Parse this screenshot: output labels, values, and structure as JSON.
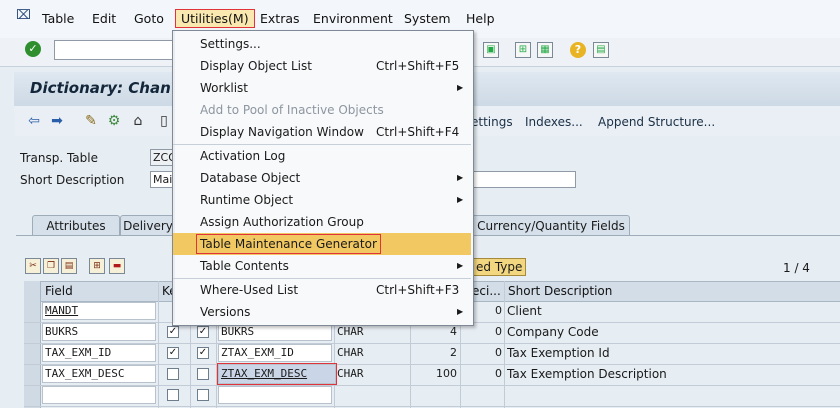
{
  "menubar": {
    "items": [
      "Table",
      "Edit",
      "Goto",
      "Utilities(M)",
      "Extras",
      "Environment",
      "System",
      "Help"
    ]
  },
  "title": "Dictionary: Chan",
  "app_toolbar": {
    "links": [
      "ettings",
      "Indexes...",
      "Append Structure..."
    ]
  },
  "form": {
    "transp_table_label": "Transp. Table",
    "transp_table_value": "ZCO",
    "short_desc_label": "Short Description",
    "short_desc_value": "Mai"
  },
  "tabs": [
    "Attributes",
    "Delivery",
    "Currency/Quantity Fields"
  ],
  "grid": {
    "tab_partial": "ed Type",
    "counter": "1 / 4",
    "headers": {
      "field": "Field",
      "key": "Ke",
      "deci": "eci...",
      "short_desc": "Short Description"
    },
    "rows": [
      {
        "field": "MANDT",
        "key": "",
        "init": "",
        "element": "",
        "type": "",
        "length": "",
        "decimals": "0",
        "desc": "Client"
      },
      {
        "field": "BUKRS",
        "key": "✓",
        "init": "✓",
        "element": "BUKRS",
        "type": "CHAR",
        "length": "4",
        "decimals": "0",
        "desc": "Company Code"
      },
      {
        "field": "TAX_EXM_ID",
        "key": "✓",
        "init": "✓",
        "element": "ZTAX_EXM_ID",
        "type": "CHAR",
        "length": "2",
        "decimals": "0",
        "desc": "Tax Exemption Id"
      },
      {
        "field": "TAX_EXM_DESC",
        "key": "",
        "init": "",
        "element": "ZTAX_EXM_DESC",
        "type": "CHAR",
        "length": "100",
        "decimals": "0",
        "desc": "Tax Exemption Description"
      }
    ]
  },
  "dropdown": {
    "items": [
      {
        "label": "Settings...",
        "shortcut": "",
        "submenu": false
      },
      {
        "label": "Display Object List",
        "shortcut": "Ctrl+Shift+F5",
        "submenu": false
      },
      {
        "label": "Worklist",
        "shortcut": "",
        "submenu": true
      },
      {
        "label": "Add to Pool of Inactive Objects",
        "shortcut": "",
        "submenu": false
      },
      {
        "label": "Display Navigation Window",
        "shortcut": "Ctrl+Shift+F4",
        "submenu": false
      },
      {
        "label": "Activation Log",
        "shortcut": "",
        "submenu": false
      },
      {
        "label": "Database Object",
        "shortcut": "",
        "submenu": true
      },
      {
        "label": "Runtime Object",
        "shortcut": "",
        "submenu": true
      },
      {
        "label": "Assign Authorization Group",
        "shortcut": "",
        "submenu": false
      },
      {
        "label": "Table Maintenance Generator",
        "shortcut": "",
        "submenu": false
      },
      {
        "label": "Table Contents",
        "shortcut": "",
        "submenu": true
      },
      {
        "label": "Where-Used List",
        "shortcut": "Ctrl+Shift+F3",
        "submenu": false
      },
      {
        "label": "Versions",
        "shortcut": "",
        "submenu": true
      }
    ]
  },
  "colors": {
    "highlight": "#f2c862",
    "annotation_red": "#e0343a",
    "title_text": "#13263a"
  },
  "icons": [
    "enter-check-icon",
    "back-arrow-icon",
    "forward-arrow-icon",
    "magic-wand-icon",
    "where-used-icon",
    "hierarchy-icon",
    "save-icon",
    "help-icon",
    "layout-icon",
    "cut-icon",
    "copy-icon",
    "paste-icon",
    "insert-row-icon",
    "delete-row-icon"
  ]
}
